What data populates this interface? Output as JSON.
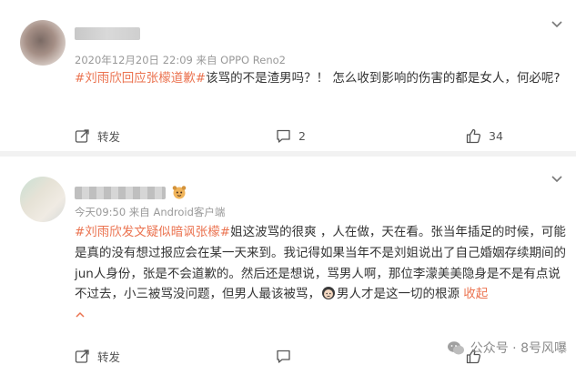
{
  "comments": [
    {
      "meta": "2020年12月20日 22:09  来自 OPPO Reno2",
      "topic": "#刘雨欣回应张檬道歉#",
      "text": "该骂的不是渣男吗？！ 怎么收到影响的伤害的都是女人，何必呢?",
      "actions": {
        "repost": "转发",
        "comment_count": "2",
        "like_count": "34"
      }
    },
    {
      "meta": "今天09:50  来自 Android客户端",
      "topic": "#刘雨欣发文疑似暗讽张檬#",
      "text_a": "姐这波骂的很爽 ，人在做，天在看。张当年插足的时候，可能是真的没有想过报应会在某一天来到。我记得如果当年不是刘姐说出了自己婚姻存续期间的jun人身份，张是不会道歉的。然后还是想说，骂男人啊，那位李濛美美隐身是不是有点说不过去，小三被骂没问题，但男人最该被骂，",
      "text_b": "男人才是这一切的根源",
      "collapse": "收起",
      "actions": {
        "repost": "转发"
      }
    }
  ],
  "watermark": {
    "text": "公众号 · 8号风嚗"
  },
  "colors": {
    "topic": "#eb7350",
    "meta": "#999999",
    "background": "#f2f2f2"
  }
}
